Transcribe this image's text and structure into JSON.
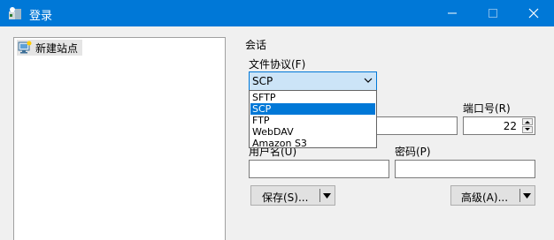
{
  "window": {
    "title": "登录"
  },
  "site_tree": {
    "items": [
      {
        "label": "新建站点",
        "icon": "computer-icon"
      }
    ]
  },
  "session": {
    "group_label": "会话",
    "protocol_label": "文件协议(F)",
    "protocol_value": "SCP",
    "protocol_options": [
      "SFTP",
      "SCP",
      "FTP",
      "WebDAV",
      "Amazon S3"
    ],
    "port_label": "端口号(R)",
    "port_value": "22",
    "username_label": "用户名(U)",
    "password_label": "密码(P)",
    "host_value": "",
    "username_value": "",
    "password_value": ""
  },
  "buttons": {
    "save_label": "保存(S)...",
    "advanced_label": "高级(A)..."
  },
  "colors": {
    "titlebar": "#0078d7",
    "selection": "#0078d7",
    "select_bg": "#cce4f7"
  }
}
